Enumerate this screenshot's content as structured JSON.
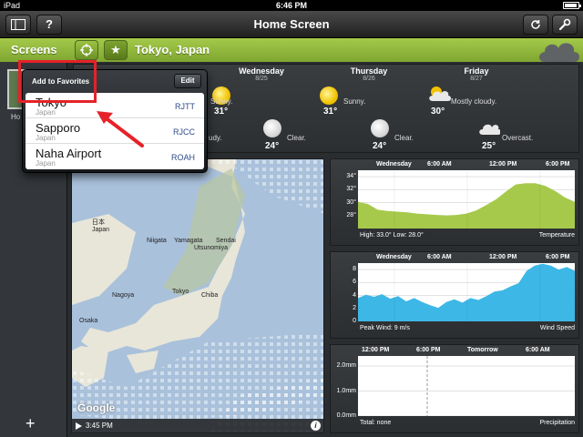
{
  "status_bar": {
    "carrier": "iPad",
    "time": "6:46 PM",
    "battery_fraction": 0.9
  },
  "nav": {
    "title": "Home Screen",
    "left_icons": [
      "sidebar-icon",
      "help-icon"
    ],
    "help_label": "?",
    "right_icons": [
      "refresh-icon",
      "wrench-icon"
    ]
  },
  "toolbar": {
    "screens_label": "Screens",
    "location": "Tokyo, Japan",
    "icons": [
      "locate-icon",
      "star-icon"
    ]
  },
  "sidebar": {
    "thumb_label": "Ho",
    "add_label": "+"
  },
  "forecast": {
    "days": [
      {
        "name": "Wednesday",
        "date": "8/25"
      },
      {
        "name": "Thursday",
        "date": "8/26"
      },
      {
        "name": "Friday",
        "date": "8/27"
      }
    ],
    "day_items": [
      {
        "label": "Sunny.",
        "temp": "31°",
        "icon": "sun-icon"
      },
      {
        "label": "Sunny.",
        "temp": "31°",
        "icon": "sun-icon"
      },
      {
        "label": "Mostly cloudy.",
        "temp": "30°",
        "icon": "partly-cloudy-icon"
      }
    ],
    "night_items": [
      {
        "label": "udy.",
        "temp": "",
        "icon": ""
      },
      {
        "label": "Clear.",
        "temp": "24°",
        "icon": "moon-icon"
      },
      {
        "label": "Clear.",
        "temp": "24°",
        "icon": "moon-icon"
      },
      {
        "label": "Overcast.",
        "temp": "25°",
        "icon": "cloud-icon"
      }
    ]
  },
  "map": {
    "time": "3:45 PM",
    "attribution": "Google",
    "info": "i",
    "labels": {
      "nihon": "日本",
      "japan": "Japan",
      "niigata": "Niigata",
      "yamagata": "Yamagata",
      "sendai": "Sendai",
      "utsunomiya": "Utsunomiya",
      "nagoya": "Nagoya",
      "tokyo": "Tokyo",
      "chiba": "Chiba",
      "osaka": "Osaka"
    }
  },
  "chart_data": [
    {
      "type": "area",
      "title": "Temperature",
      "x_headers": [
        "Wednesday",
        "6:00 AM",
        "12:00 PM",
        "6:00 PM"
      ],
      "yticks": [
        "34°",
        "32°",
        "30°",
        "28°"
      ],
      "ylim": [
        26,
        35
      ],
      "values": [
        30.1,
        29.8,
        28.9,
        28.7,
        28.6,
        28.5,
        28.3,
        28.2,
        28.1,
        28.0,
        28.1,
        28.3,
        28.8,
        29.6,
        30.5,
        31.7,
        32.8,
        33.0,
        33.0,
        32.6,
        31.8,
        30.8,
        30.1
      ],
      "footer_left": "High: 33.0°   Low: 28.0°",
      "footer_right": "Temperature",
      "color": "#a6c94b"
    },
    {
      "type": "area",
      "title": "Wind Speed",
      "x_headers": [
        "Wednesday",
        "6:00 AM",
        "12:00 PM",
        "6:00 PM"
      ],
      "yticks": [
        "8",
        "6",
        "4",
        "2",
        "0"
      ],
      "ylim": [
        0,
        9
      ],
      "values": [
        3.6,
        4.1,
        3.8,
        4.2,
        3.5,
        3.9,
        3.1,
        3.6,
        3.0,
        2.5,
        2.1,
        3.0,
        3.4,
        2.9,
        3.6,
        3.3,
        3.9,
        4.6,
        4.8,
        5.4,
        5.9,
        7.8,
        8.6,
        8.9,
        8.6,
        8.0,
        8.4,
        7.8
      ],
      "footer_left": "Peak Wind: 9 m/s",
      "footer_right": "Wind Speed",
      "color": "#3db7e6"
    },
    {
      "type": "bar",
      "title": "Precipitation",
      "x_headers": [
        "12:00 PM",
        "6:00 PM",
        "Tomorrow",
        "6:00 AM"
      ],
      "yticks": [
        "2.0mm",
        "1.0mm",
        "0.0mm"
      ],
      "ylim": [
        0,
        2.4
      ],
      "values": [],
      "footer_left": "Total: none",
      "footer_right": "Precipitation",
      "color": "#3db7e6"
    }
  ],
  "popover": {
    "title": "Add to Favorites",
    "edit_label": "Edit",
    "rows": [
      {
        "name": "Tokyo",
        "country": "Japan",
        "code": "RJTT"
      },
      {
        "name": "Sapporo",
        "country": "Japan",
        "code": "RJCC"
      },
      {
        "name": "Naha Airport",
        "country": "Japan",
        "code": "ROAH"
      }
    ]
  },
  "annotation": {
    "color": "#e52229"
  }
}
